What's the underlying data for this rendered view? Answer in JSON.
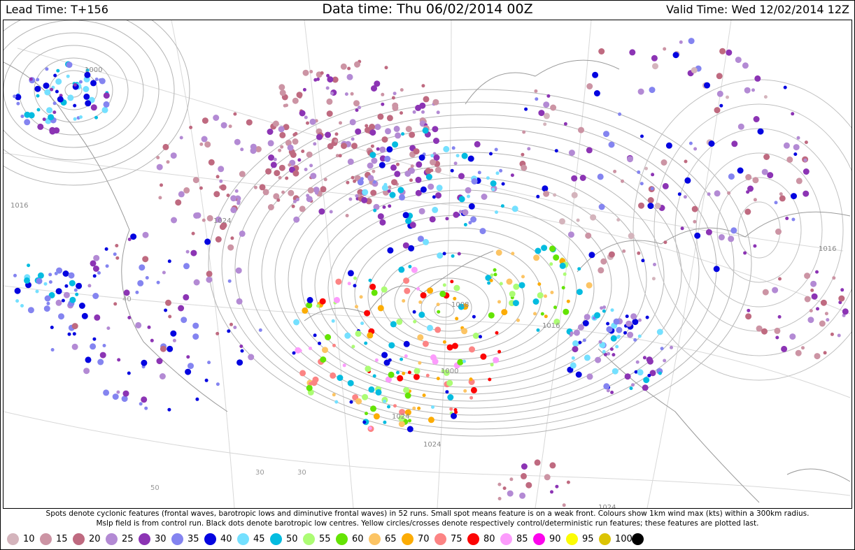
{
  "header": {
    "lead_time": "Lead Time: T+156",
    "data_time": "Data time:  Thu 06/02/2014 00Z",
    "valid_time": "Valid Time: Wed 12/02/2014 12Z"
  },
  "notes": {
    "line1": "Spots denote cyclonic features (frontal waves, barotropic lows and diminutive frontal waves) in 52 runs. Small spot means feature is on a weak front. Colours show 1km wind max (kts) within a 300km radius.",
    "line2": "Mslp field is from control run. Black dots denote barotropic low centres. Yellow circles/crosses denote respectively control/deterministic run features; these features are plotted last."
  },
  "legend": [
    {
      "label": "10",
      "color": "#d4b4bc"
    },
    {
      "label": "15",
      "color": "#cc94a4"
    },
    {
      "label": "20",
      "color": "#bf6a80"
    },
    {
      "label": "25",
      "color": "#b38ad4"
    },
    {
      "label": "30",
      "color": "#8c34b4"
    },
    {
      "label": "35",
      "color": "#8484f0"
    },
    {
      "label": "40",
      "color": "#0404e0"
    },
    {
      "label": "45",
      "color": "#74e0ff"
    },
    {
      "label": "50",
      "color": "#04bce0"
    },
    {
      "label": "55",
      "color": "#acfc74"
    },
    {
      "label": "60",
      "color": "#64e404"
    },
    {
      "label": "65",
      "color": "#fcc464"
    },
    {
      "label": "70",
      "color": "#fcac04"
    },
    {
      "label": "75",
      "color": "#fc8484"
    },
    {
      "label": "80",
      "color": "#fc0404"
    },
    {
      "label": "85",
      "color": "#fc9cfc"
    },
    {
      "label": "90",
      "color": "#fc04ec"
    },
    {
      "label": "95",
      "color": "#fcfc04"
    },
    {
      "label": "100",
      "color": "#dcc404"
    },
    {
      "label": "",
      "color": "#000000"
    }
  ],
  "isobar_labels": [
    "1000",
    "1016",
    "1024",
    "1024",
    "1008",
    "1016",
    "1024",
    "1016",
    "1000",
    "1024"
  ],
  "grid_labels": [
    "30",
    "40",
    "50",
    "30"
  ]
}
